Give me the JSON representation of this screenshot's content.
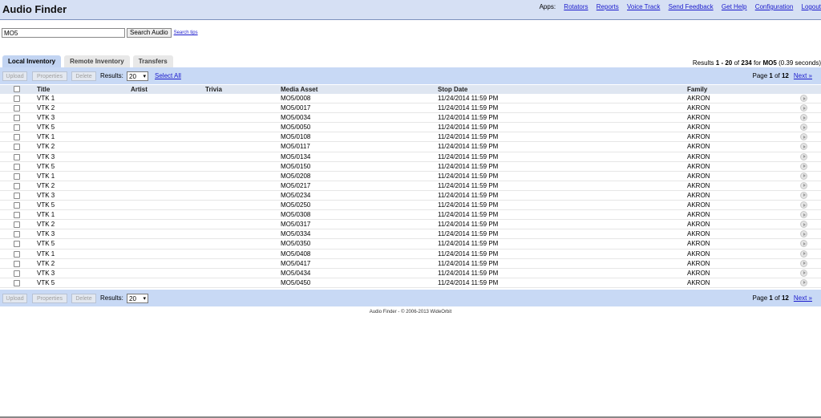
{
  "app": {
    "title": "Audio Finder"
  },
  "apps_bar": {
    "label": "Apps:",
    "links": [
      "Rotators",
      "Reports",
      "Voice Track",
      "Send Feedback",
      "Get Help",
      "Configuration",
      "Logout"
    ]
  },
  "search": {
    "value": "MO5",
    "button": "Search Audio",
    "tips": "Search tips"
  },
  "tabs": [
    "Local Inventory",
    "Remote Inventory",
    "Transfers"
  ],
  "results_info": {
    "prefix": "Results ",
    "range": "1 - 20",
    "of": " of ",
    "total": "234",
    "for": " for ",
    "query": "MO5",
    "time": " (0.39 seconds)"
  },
  "toolbar": {
    "upload": "Upload",
    "properties": "Properties",
    "delete": "Delete",
    "results_label": "Results:",
    "results_value": "20",
    "select_all": "Select All",
    "page_prefix": "Page ",
    "page": "1",
    "of": " of ",
    "pages": "12",
    "next": "Next »"
  },
  "columns": {
    "title": "Title",
    "artist": "Artist",
    "trivia": "Trivia",
    "asset": "Media Asset",
    "stop": "Stop Date",
    "family": "Family"
  },
  "rows": [
    {
      "title": "VTK 1",
      "asset": "MO5/0008",
      "stop": "11/24/2014 11:59 PM",
      "family": "AKRON"
    },
    {
      "title": "VTK 2",
      "asset": "MO5/0017",
      "stop": "11/24/2014 11:59 PM",
      "family": "AKRON"
    },
    {
      "title": "VTK 3",
      "asset": "MO5/0034",
      "stop": "11/24/2014 11:59 PM",
      "family": "AKRON"
    },
    {
      "title": "VTK 5",
      "asset": "MO5/0050",
      "stop": "11/24/2014 11:59 PM",
      "family": "AKRON"
    },
    {
      "title": "VTK 1",
      "asset": "MO5/0108",
      "stop": "11/24/2014 11:59 PM",
      "family": "AKRON"
    },
    {
      "title": "VTK 2",
      "asset": "MO5/0117",
      "stop": "11/24/2014 11:59 PM",
      "family": "AKRON"
    },
    {
      "title": "VTK 3",
      "asset": "MO5/0134",
      "stop": "11/24/2014 11:59 PM",
      "family": "AKRON"
    },
    {
      "title": "VTK 5",
      "asset": "MO5/0150",
      "stop": "11/24/2014 11:59 PM",
      "family": "AKRON"
    },
    {
      "title": "VTK 1",
      "asset": "MO5/0208",
      "stop": "11/24/2014 11:59 PM",
      "family": "AKRON"
    },
    {
      "title": "VTK 2",
      "asset": "MO5/0217",
      "stop": "11/24/2014 11:59 PM",
      "family": "AKRON"
    },
    {
      "title": "VTK 3",
      "asset": "MO5/0234",
      "stop": "11/24/2014 11:59 PM",
      "family": "AKRON"
    },
    {
      "title": "VTK 5",
      "asset": "MO5/0250",
      "stop": "11/24/2014 11:59 PM",
      "family": "AKRON"
    },
    {
      "title": "VTK 1",
      "asset": "MO5/0308",
      "stop": "11/24/2014 11:59 PM",
      "family": "AKRON"
    },
    {
      "title": "VTK 2",
      "asset": "MO5/0317",
      "stop": "11/24/2014 11:59 PM",
      "family": "AKRON"
    },
    {
      "title": "VTK 3",
      "asset": "MO5/0334",
      "stop": "11/24/2014 11:59 PM",
      "family": "AKRON"
    },
    {
      "title": "VTK 5",
      "asset": "MO5/0350",
      "stop": "11/24/2014 11:59 PM",
      "family": "AKRON"
    },
    {
      "title": "VTK 1",
      "asset": "MO5/0408",
      "stop": "11/24/2014 11:59 PM",
      "family": "AKRON"
    },
    {
      "title": "VTK 2",
      "asset": "MO5/0417",
      "stop": "11/24/2014 11:59 PM",
      "family": "AKRON"
    },
    {
      "title": "VTK 3",
      "asset": "MO5/0434",
      "stop": "11/24/2014 11:59 PM",
      "family": "AKRON"
    },
    {
      "title": "VTK 5",
      "asset": "MO5/0450",
      "stop": "11/24/2014 11:59 PM",
      "family": "AKRON"
    }
  ],
  "footer": "Audio Finder - © 2006-2013 WideOrbit",
  "icons": {
    "row_action": "play-icon",
    "select_caret": "chevron-down-icon"
  },
  "colors": {
    "header_bg": "#d6e0f4",
    "toolbar_bg": "#c8d9f5",
    "link": "#1a1acc",
    "active_tab": "#c2d4f2"
  }
}
